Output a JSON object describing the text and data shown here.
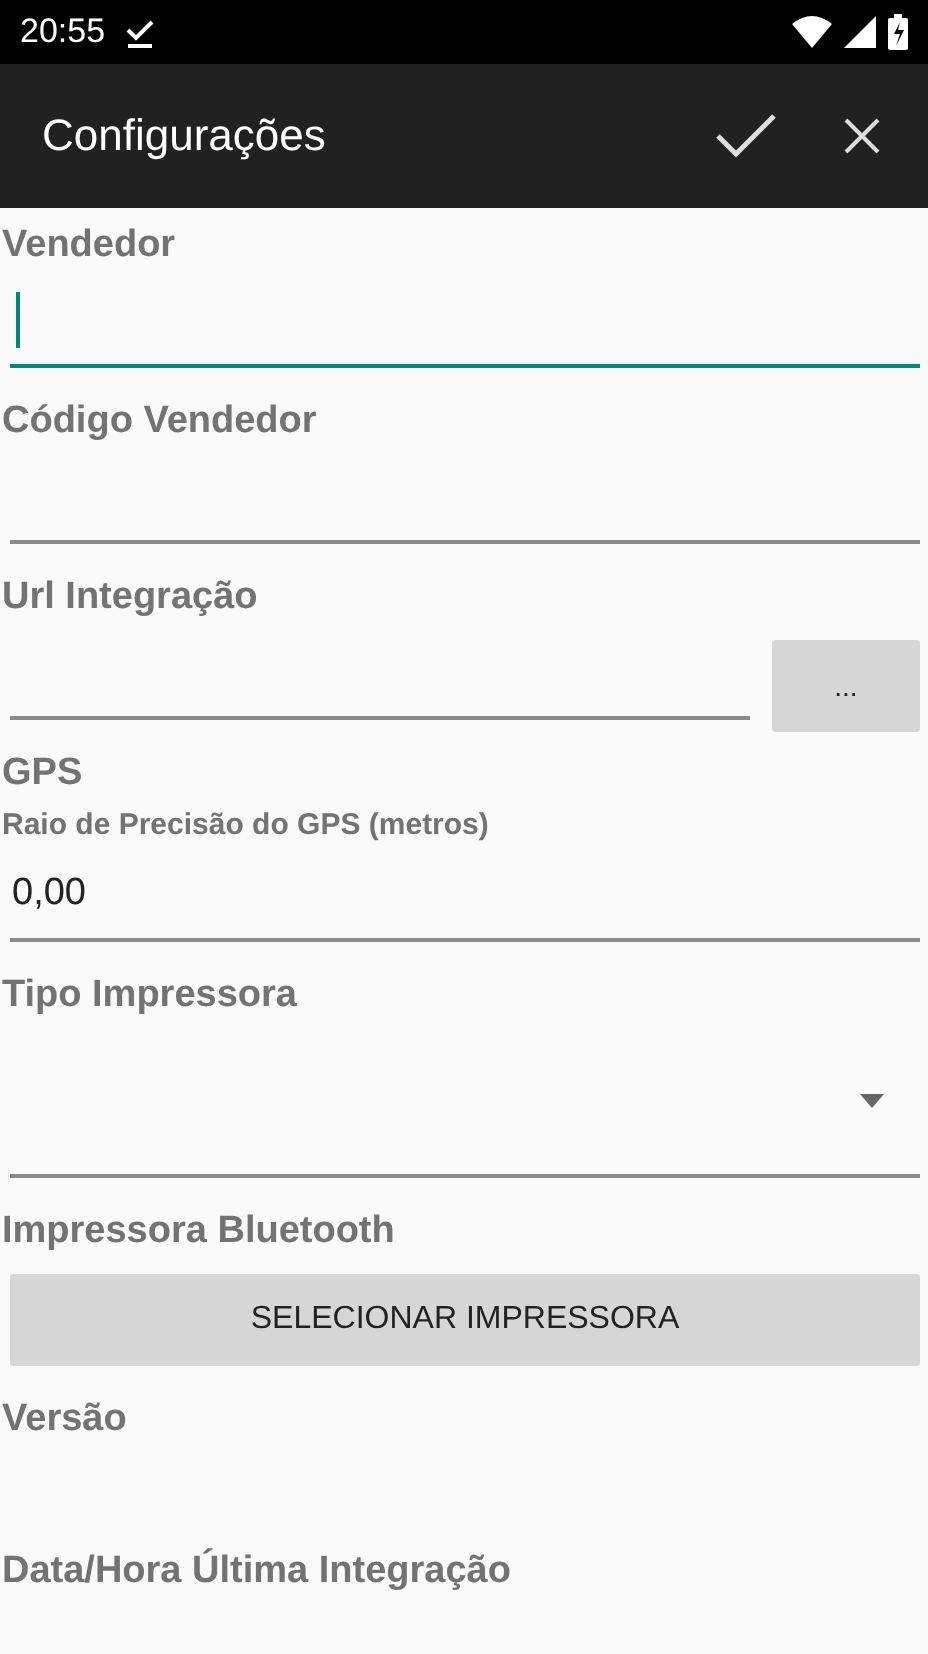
{
  "status_bar": {
    "time": "20:55"
  },
  "app_bar": {
    "title": "Configurações"
  },
  "items": [
    {
      "kind": "heading",
      "text": "Vendedor"
    },
    {
      "kind": "text_field",
      "focused": true
    },
    {
      "kind": "heading",
      "text": "Código Vendedor"
    },
    {
      "kind": "text_field",
      "focused": false
    },
    {
      "kind": "heading",
      "text": "Url Integração"
    },
    {
      "kind": "field_with_button",
      "focused": false,
      "button": "..."
    },
    {
      "kind": "heading",
      "text": "GPS"
    },
    {
      "kind": "subheading",
      "text": "Raio de Precisão do GPS (metros)"
    },
    {
      "kind": "text_field",
      "value": "0,00",
      "focused": false
    },
    {
      "kind": "heading",
      "text": "Tipo Impressora"
    },
    {
      "kind": "spinner"
    },
    {
      "kind": "heading",
      "text": "Impressora Bluetooth"
    },
    {
      "kind": "button",
      "label": "SELECIONAR IMPRESSORA"
    },
    {
      "kind": "heading",
      "text": "Versão"
    },
    {
      "kind": "heading",
      "text": "Data/Hora Última Integração"
    }
  ]
}
